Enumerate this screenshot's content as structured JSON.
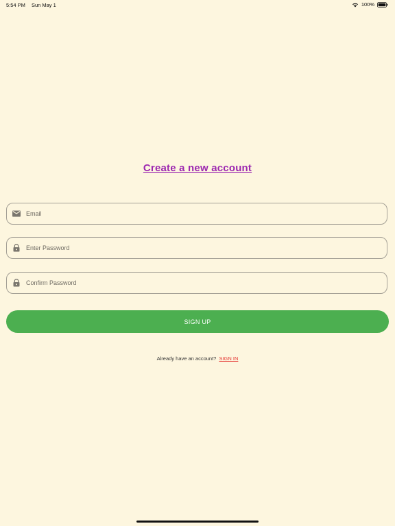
{
  "status_bar": {
    "time": "5:54 PM",
    "date": "Sun May 1",
    "battery": "100%"
  },
  "title": "Create a new account",
  "fields": {
    "email": {
      "placeholder": "Email",
      "value": "",
      "icon": "mail-icon"
    },
    "password": {
      "placeholder": "Enter Password",
      "value": "",
      "icon": "lock-icon"
    },
    "confirm_password": {
      "placeholder": "Confirm Password",
      "value": "",
      "icon": "lock-icon"
    }
  },
  "signup_button": {
    "label": "SIGN UP"
  },
  "signin_prompt": {
    "text": "Already have an account?",
    "link": "SIGN IN"
  },
  "colors": {
    "background": "#fdf6df",
    "title": "#9c27b0",
    "button": "#4caf50",
    "link": "#e53935"
  }
}
